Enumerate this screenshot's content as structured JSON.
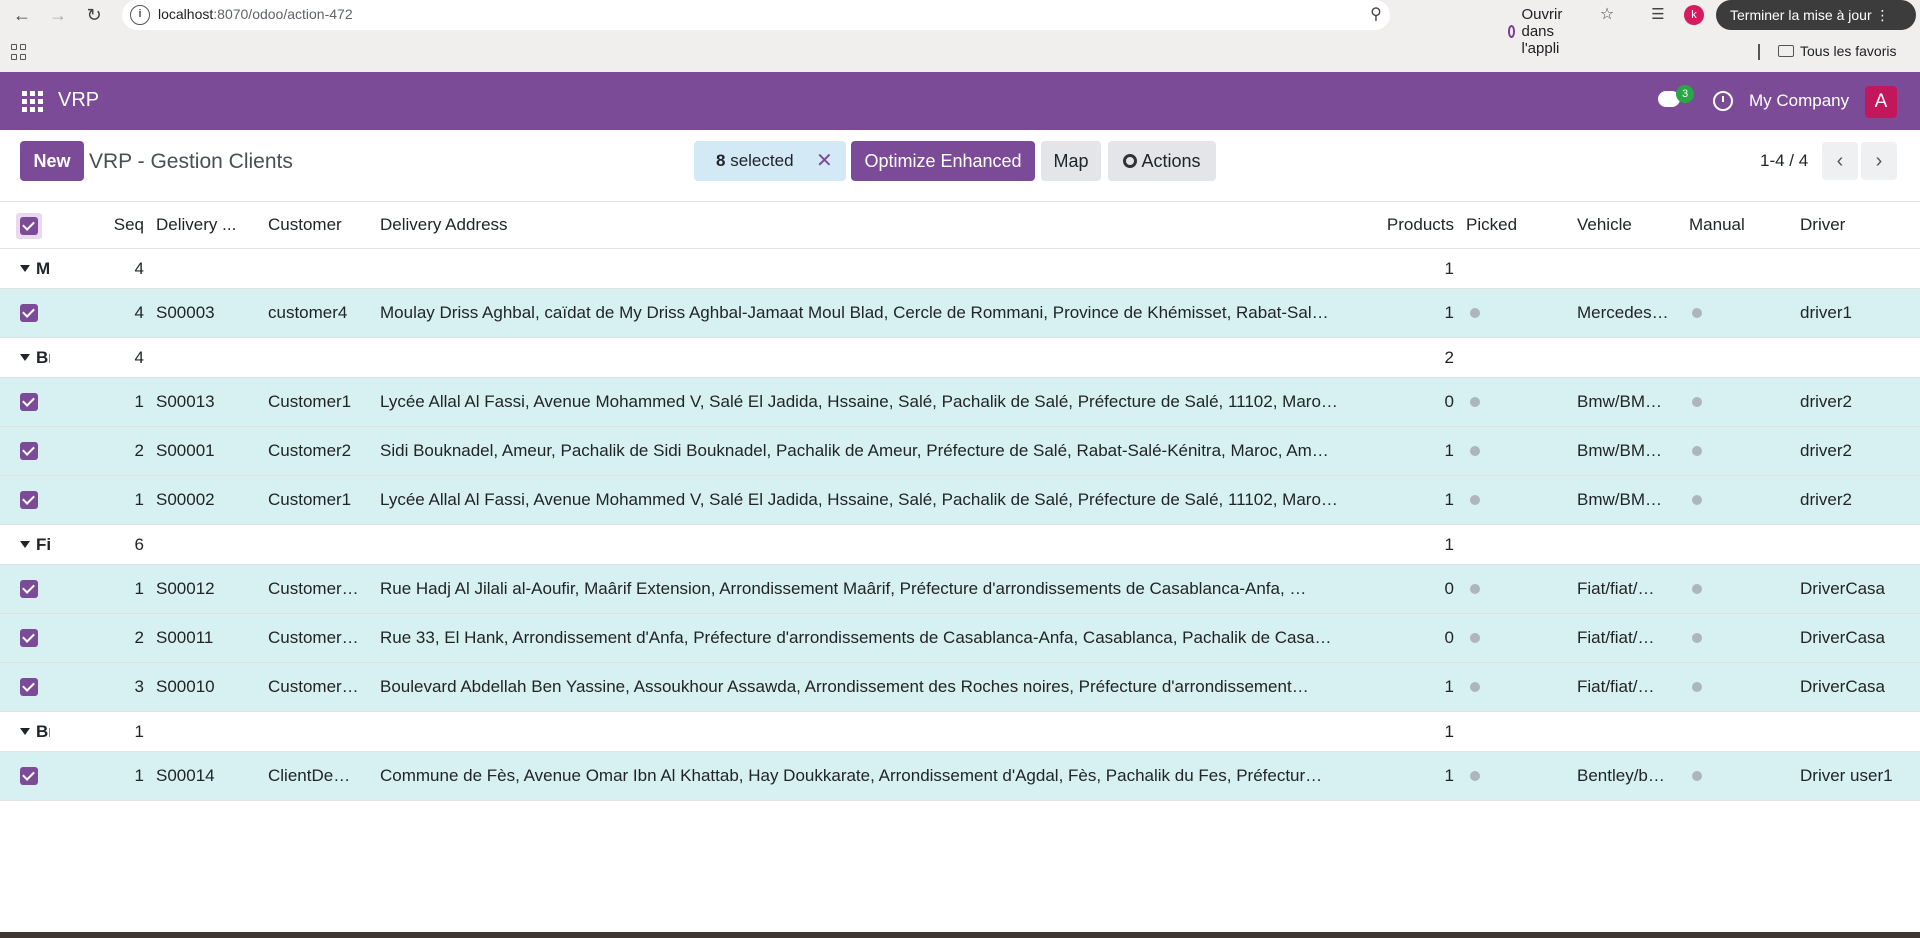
{
  "browser": {
    "url_host": "localhost",
    "url_path": ":8070/odoo/action-472",
    "open_in_app": "Ouvrir dans l'appli",
    "profile_initial": "k",
    "update_button": "Terminer la mise à jour",
    "bookmarks_folder": "Tous les favoris"
  },
  "navbar": {
    "brand": "VRP",
    "chat_badge": "3",
    "company": "My Company",
    "avatar_initial": "A"
  },
  "control_panel": {
    "new_label": "New",
    "title": "VRP - Gestion Clients",
    "selected_count": "8",
    "selected_label": "selected",
    "optimize_label": "Optimize Enhanced",
    "map_label": "Map",
    "actions_label": "Actions",
    "pager": "1-4 / 4"
  },
  "columns": {
    "seq": "Seq",
    "delivery": "Delivery ...",
    "customer": "Customer",
    "address": "Delivery Address",
    "products": "Products",
    "picked": "Picked",
    "vehicle": "Vehicle",
    "manual": "Manual",
    "driver": "Driver"
  },
  "groups": [
    {
      "name": "M",
      "seq": "4",
      "products": "1",
      "rows": [
        {
          "seq": "4",
          "delivery": "S00003",
          "customer": "customer4",
          "address": "Moulay Driss Aghbal, caïdat de My Driss Aghbal-Jamaat Moul Blad, Cercle de Rommani, Province de Khémisset, Rabat-Sal…",
          "products": "1",
          "vehicle": "Mercedes…",
          "driver": "driver1"
        }
      ]
    },
    {
      "name": "Bı",
      "seq": "4",
      "products": "2",
      "rows": [
        {
          "seq": "1",
          "delivery": "S00013",
          "customer": "Customer1",
          "address": "Lycée Allal Al Fassi, Avenue Mohammed V, Salé El Jadida, Hssaine, Salé, Pachalik de Salé, Préfecture de Salé, 11102, Maro…",
          "products": "0",
          "vehicle": "Bmw/BM…",
          "driver": "driver2"
        },
        {
          "seq": "2",
          "delivery": "S00001",
          "customer": "Customer2",
          "address": "Sidi Bouknadel, Ameur, Pachalik de Sidi Bouknadel, Pachalik de Ameur, Préfecture de Salé, Rabat-Salé-Kénitra, Maroc, Am…",
          "products": "1",
          "vehicle": "Bmw/BM…",
          "driver": "driver2"
        },
        {
          "seq": "1",
          "delivery": "S00002",
          "customer": "Customer1",
          "address": "Lycée Allal Al Fassi, Avenue Mohammed V, Salé El Jadida, Hssaine, Salé, Pachalik de Salé, Préfecture de Salé, 11102, Maro…",
          "products": "1",
          "vehicle": "Bmw/BM…",
          "driver": "driver2"
        }
      ]
    },
    {
      "name": "Fi",
      "seq": "6",
      "products": "1",
      "rows": [
        {
          "seq": "1",
          "delivery": "S00012",
          "customer": "Customer…",
          "address": "Rue Hadj Al Jilali al-Aoufir, Maârif Extension, Arrondissement Maârif, Préfecture d'arrondissements de Casablanca-Anfa, …",
          "products": "0",
          "vehicle": "Fiat/fiat/…",
          "driver": "DriverCasa"
        },
        {
          "seq": "2",
          "delivery": "S00011",
          "customer": "Customer…",
          "address": "Rue 33, El Hank, Arrondissement d'Anfa, Préfecture d'arrondissements de Casablanca-Anfa, Casablanca, Pachalik de Casa…",
          "products": "0",
          "vehicle": "Fiat/fiat/…",
          "driver": "DriverCasa"
        },
        {
          "seq": "3",
          "delivery": "S00010",
          "customer": "Customer…",
          "address": "Boulevard Abdellah Ben Yassine, Assoukhour Assawda, Arrondissement des Roches noires, Préfecture d'arrondissement…",
          "products": "1",
          "vehicle": "Fiat/fiat/…",
          "driver": "DriverCasa"
        }
      ]
    },
    {
      "name": "Bı",
      "seq": "1",
      "products": "1",
      "rows": [
        {
          "seq": "1",
          "delivery": "S00014",
          "customer": "ClientDe…",
          "address": "Commune de Fès, Avenue Omar Ibn Al Khattab, Hay Doukkarate, Arrondissement d'Agdal, Fès, Pachalik du Fes, Préfectur…",
          "products": "1",
          "vehicle": "Bentley/b…",
          "driver": "Driver user1"
        }
      ]
    }
  ],
  "colors": {
    "primary": "#7c4b98",
    "row_selected": "#d7f0f2",
    "badge": "#28a745",
    "avatar": "#c2185b"
  }
}
